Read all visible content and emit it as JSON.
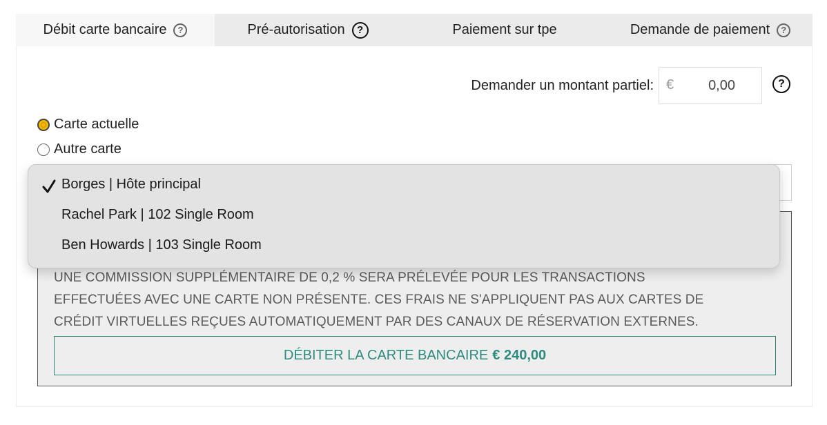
{
  "tabs": [
    {
      "label": "Débit carte bancaire",
      "active": true,
      "help_icon": "question-circle-icon"
    },
    {
      "label": "Pré-autorisation",
      "active": false,
      "help_icon": "question-circle-icon"
    },
    {
      "label": "Paiement sur tpe",
      "active": false
    },
    {
      "label": "Demande de paiement",
      "active": false,
      "help_icon": "question-circle-icon"
    }
  ],
  "partial": {
    "label": "Demander un montant partiel:",
    "currency": "€",
    "value": "0,00"
  },
  "card_options": [
    {
      "label": "Carte actuelle",
      "checked": true
    },
    {
      "label": "Autre carte",
      "checked": false
    }
  ],
  "guest_dropdown": {
    "selected_index": 0,
    "options": [
      "Borges | Hôte principal",
      "Rachel Park | 102 Single Room",
      "Ben Howards | 103 Single Room"
    ]
  },
  "notice": {
    "lines": [
      "UNE COMMISSION SUPPLÉMENTAIRE DE 0,2 % SERA PRÉLEVÉE POUR LES TRANSACTIONS",
      "EFFECTUÉES AVEC UNE CARTE NON PRÉSENTE. CES FRAIS NE S'APPLIQUENT PAS AUX CARTES DE",
      "CRÉDIT VIRTUELLES REÇUES AUTOMATIQUEMENT PAR DES CANAUX DE RÉSERVATION EXTERNES."
    ]
  },
  "charge_button": {
    "label": "DÉBITER LA CARTE BANCAIRE",
    "amount": "€ 240,00"
  },
  "colors": {
    "accent": "#2e8b7f",
    "radio_selected": "#f5b800"
  }
}
